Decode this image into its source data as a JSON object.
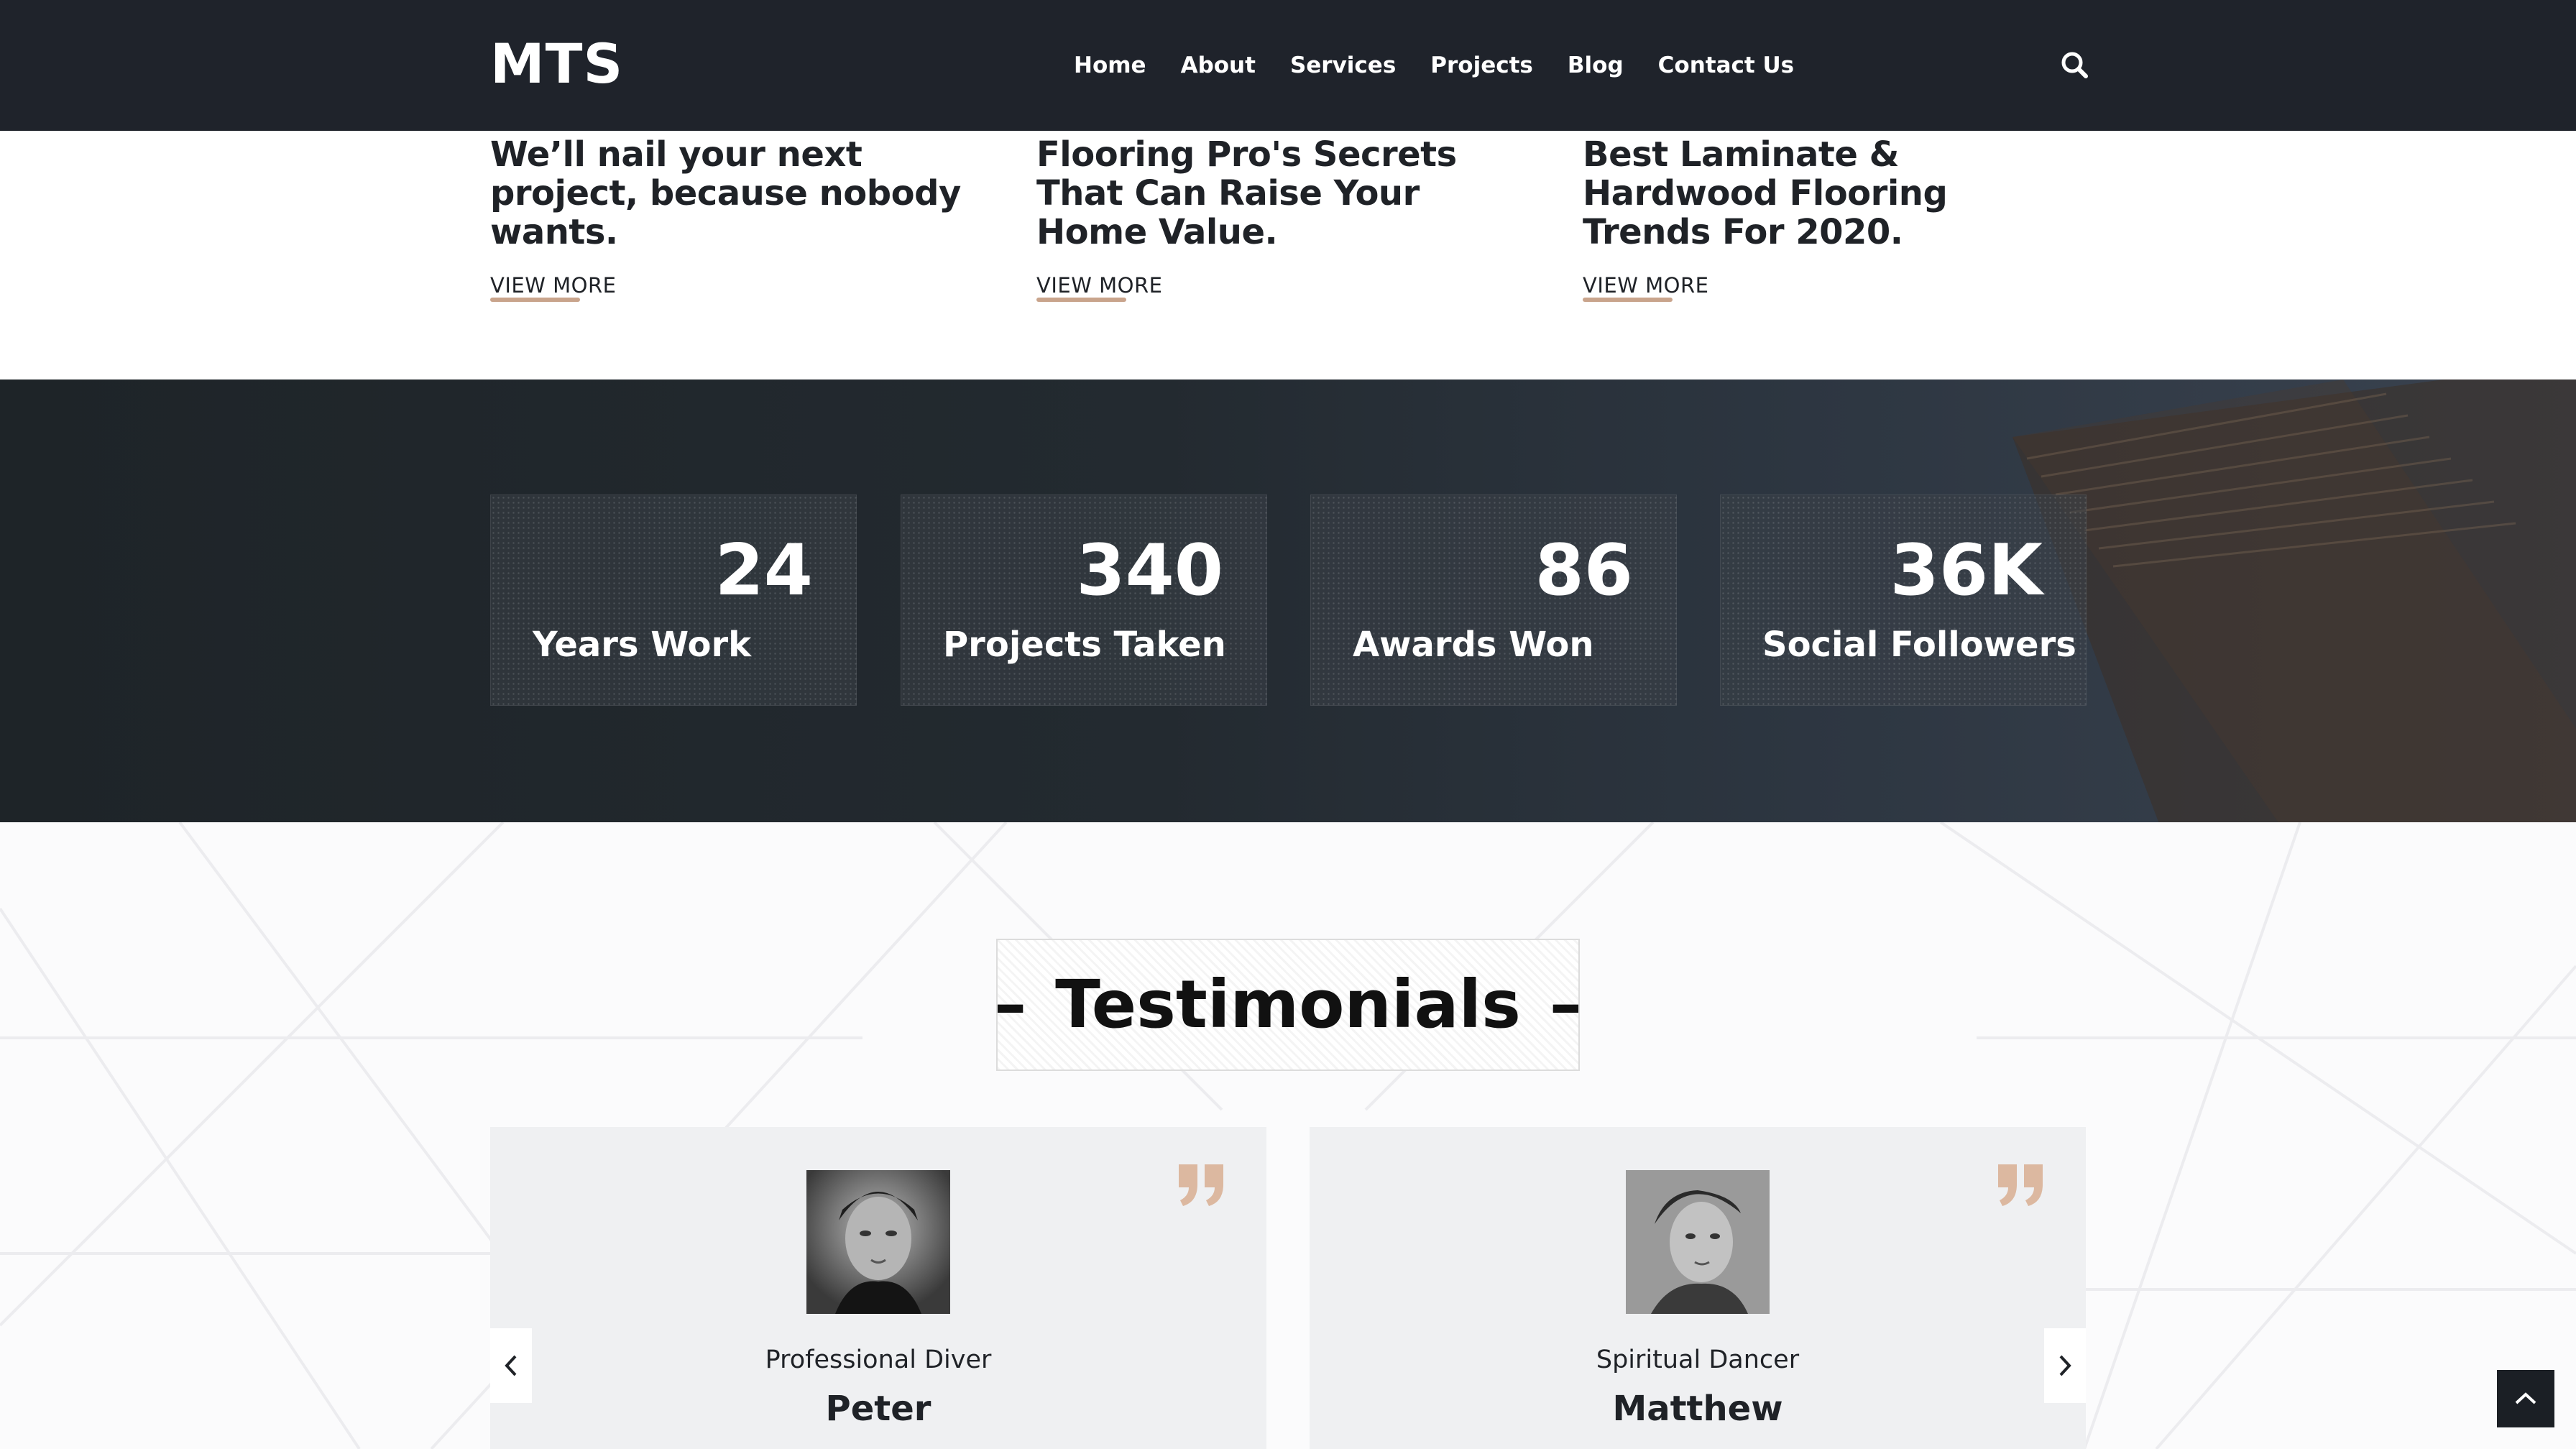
{
  "header": {
    "logo": "MTS",
    "nav": [
      "Home",
      "About",
      "Services",
      "Projects",
      "Blog",
      "Contact Us"
    ],
    "search_icon": "search-icon"
  },
  "blog": {
    "cards": [
      {
        "title": "We’ll nail your next project, because nobody wants.",
        "link": "VIEW MORE"
      },
      {
        "title": "Flooring Pro's Secrets That Can Raise Your Home Value.",
        "link": "VIEW MORE"
      },
      {
        "title": "Best Laminate & Hardwood Flooring Trends For 2020.",
        "link": "VIEW MORE"
      }
    ],
    "accent_color": "#c9a48c"
  },
  "stats": {
    "items": [
      {
        "value": "24",
        "label": "Years Work"
      },
      {
        "value": "340",
        "label": "Projects Taken"
      },
      {
        "value": "86",
        "label": "Awards Won"
      },
      {
        "value": "36K",
        "label": "Social Followers"
      }
    ]
  },
  "testimonials": {
    "heading": "Testimonials",
    "dash": "–",
    "items": [
      {
        "role": "Professional Diver",
        "name": "Peter"
      },
      {
        "role": "Spiritual Dancer",
        "name": "Matthew"
      }
    ],
    "prev_icon": "chevron-left-icon",
    "next_icon": "chevron-right-icon",
    "quote_icon": "quote-icon",
    "quote_color": "#dcb8a0"
  },
  "scroll_top_icon": "chevron-up-icon"
}
